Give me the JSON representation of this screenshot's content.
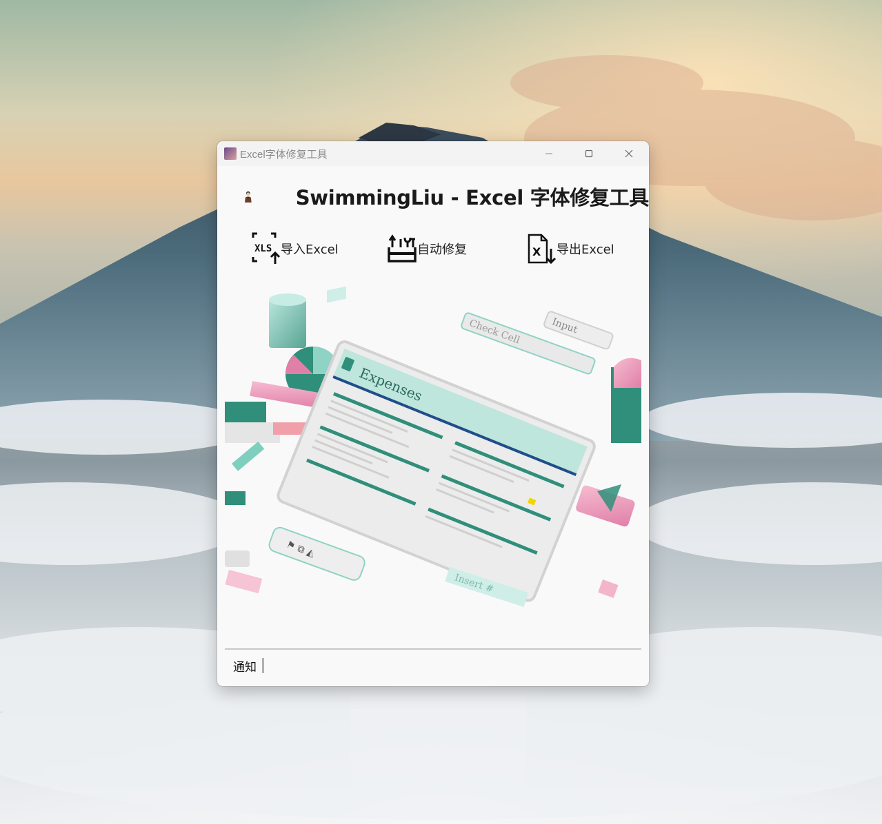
{
  "window": {
    "title": "Excel字体修复工具",
    "controls": [
      "minimize-icon",
      "maximize-icon",
      "close-icon"
    ]
  },
  "header": {
    "heading": "SwimmingLiu - Excel 字体修复工具"
  },
  "toolbar": {
    "import_label": "导入Excel",
    "import_icon": "xls-import-icon",
    "repair_label": "自动修复",
    "repair_icon": "toolbox-icon",
    "export_label": "导出Excel",
    "export_icon": "excel-export-icon"
  },
  "illustration": {
    "sheet_title": "Expenses",
    "tag_check_cell": "Check Cell",
    "tag_input": "Input",
    "tag_insert": "Insert #"
  },
  "status": {
    "label": "通知"
  },
  "colors": {
    "accent_teal": "#2f8f7a",
    "accent_pink": "#e07fa8",
    "window_bg": "#f9f9f9"
  }
}
